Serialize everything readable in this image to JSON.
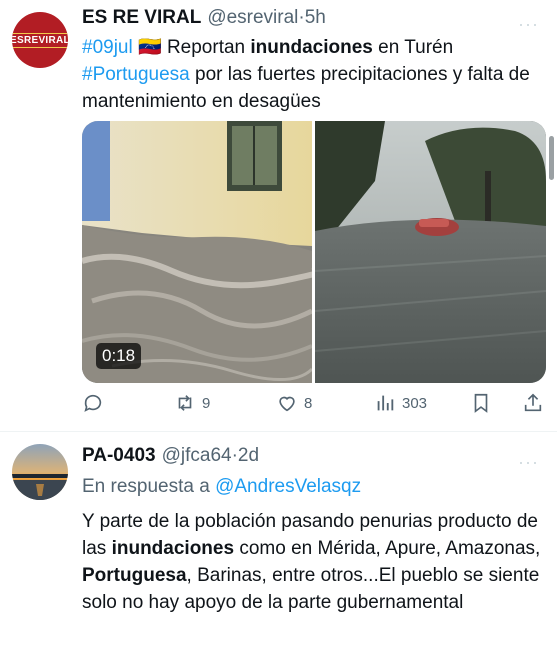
{
  "tweet1": {
    "avatar_text": "ESREVIRAL",
    "name": "ES RE VIRAL",
    "handle": "@esreviral",
    "time": "5h",
    "more": "···",
    "text_tag1": "#09jul",
    "text_flag": "🇻🇪",
    "text_part1": " Reportan ",
    "text_bold1": "inundaciones",
    "text_part2": " en Turén",
    "text_tag2": "#Portuguesa",
    "text_part3": " por las fuertes precipitaciones y falta de mantenimiento en desagües",
    "video_duration": "0:18",
    "actions": {
      "reply_count": "",
      "retweet_count": "9",
      "like_count": "8",
      "views_count": "303"
    }
  },
  "tweet2": {
    "name": "PA-0403",
    "handle": "@jfca64",
    "time": "2d",
    "more": "···",
    "reply_prefix": "En respuesta a ",
    "reply_handle": "@AndresVelasqz",
    "text_part1": "Y parte de la población pasando penurias producto de las ",
    "text_bold1": "inundaciones",
    "text_part2": " como en Mérida, Apure, Amazonas, ",
    "text_bold2": "Portuguesa",
    "text_part3": ", Barinas, entre otros...El pueblo se siente solo no hay apoyo de la parte gubernamental"
  },
  "colors": {
    "link": "#1d9bf0",
    "muted": "#536471",
    "avatar_brand": "#b21d24"
  }
}
